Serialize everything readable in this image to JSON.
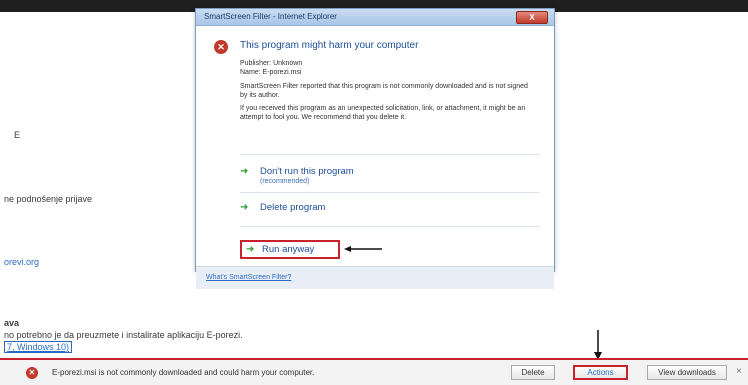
{
  "dialog": {
    "title": "SmartScreen Filter - Internet Explorer",
    "close_label": "X",
    "headline": "This program might harm your computer",
    "publisher": "Publisher: Unknown",
    "name": "Name: E-porezi.msi",
    "reported": "SmartScreen Filter reported that this program is not commonly downloaded and is not signed by its author.",
    "advice": "If you received this program as an unexpected solicitation, link, or attachment, it might be an attempt to fool you. We recommend that you delete it.",
    "options": [
      {
        "label": "Don't run this program",
        "sub": "(recommended)"
      },
      {
        "label": "Delete program",
        "sub": ""
      },
      {
        "label": "Run anyway",
        "sub": ""
      }
    ],
    "footer_link": "What's SmartScreen Filter?"
  },
  "background": {
    "text1": "ne podnošenje prijave",
    "link1": "orevi.org",
    "heading": "ava",
    "text2": "no potrebno je da preuzmete i instalirate aplikaciju E-porezi.",
    "link2": "7, Windows 10)"
  },
  "notification": {
    "message": "E-porezi.msi is not commonly downloaded and could harm your computer.",
    "delete_label": "Delete",
    "actions_label": "Actions",
    "view_downloads_label": "View downloads",
    "close_label": "×"
  },
  "colors": {
    "highlight": "#c8232c",
    "link": "#2a6cc4",
    "warning": "#c0392b"
  }
}
